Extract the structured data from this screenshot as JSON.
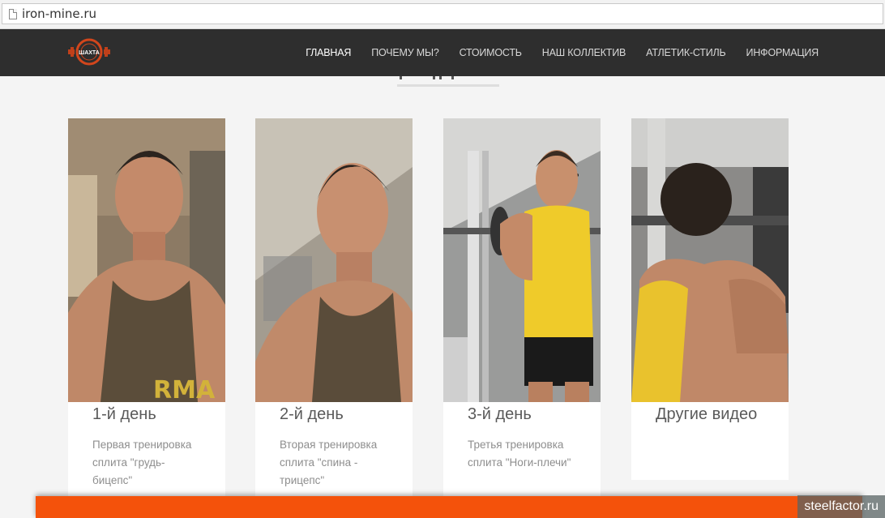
{
  "browser": {
    "url": "iron-mine.ru"
  },
  "site": {
    "logo_text": "ШАХТА",
    "nav": [
      {
        "label": "ГЛАВНАЯ",
        "active": true
      },
      {
        "label": "ПОЧЕМУ МЫ?",
        "active": false
      },
      {
        "label": "СТОИМОСТЬ",
        "active": false
      },
      {
        "label": "НАШ КОЛЛЕКТИВ",
        "active": false
      },
      {
        "label": "АТЛЕТИК-СТИЛЬ",
        "active": false
      },
      {
        "label": "ИНФОРМАЦИЯ",
        "active": false
      }
    ]
  },
  "cards": [
    {
      "title": "1-й день",
      "description": "Первая тренировка сплита \"грудь-бицепс\""
    },
    {
      "title": "2-й день",
      "description": "Вторая тренировка сплита \"спина - трицепс\""
    },
    {
      "title": "3-й день",
      "description": "Третья тренировка сплита \"Ноги-плечи\""
    },
    {
      "title": "Другие видео",
      "description": ""
    }
  ],
  "watermark": "steelfactor.ru",
  "colors": {
    "navbar": "#2e2e2e",
    "accent_orange": "#f4520b",
    "page_bg": "#f4f4f4"
  }
}
